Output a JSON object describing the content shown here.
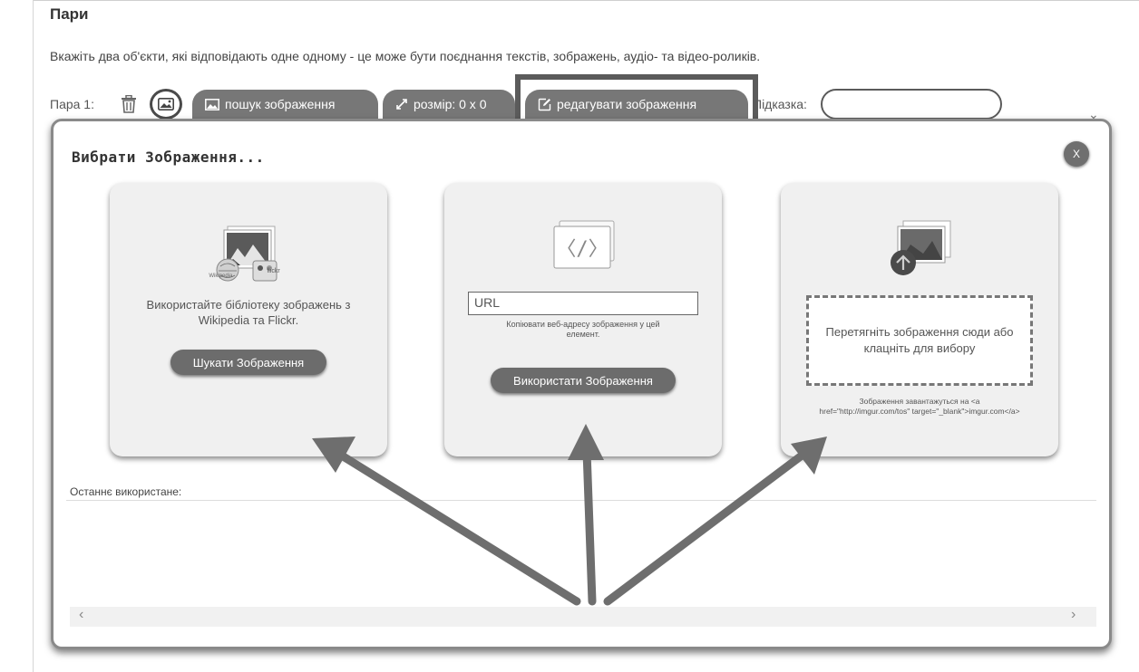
{
  "section": {
    "title": "Пари",
    "instructions": "Вкажіть два об'єкти, які відповідають одне одному - це може бути поєднання текстів, зображень, аудіо- та відео-роликів."
  },
  "pair_row": {
    "label": "Пара 1:",
    "search_image": "пошук зображення",
    "size": "розмір: 0 x 0",
    "edit_image": "редагувати зображення",
    "hint_label": "Підказка:",
    "hint_value": ""
  },
  "modal": {
    "title": "Вибрати Зображення...",
    "close": "X",
    "cards": {
      "library": {
        "description": "Використайте бібліотеку зображень з Wikipedia та Flickr.",
        "button": "Шукати Зображення",
        "icon_caption_1": "Wikipedia",
        "icon_caption_2": "flickr"
      },
      "url": {
        "input_placeholder": "URL",
        "description": "Копіювати веб-адресу зображення у цей елемент.",
        "button": "Використати Зображення"
      },
      "upload": {
        "dropzone_text": "Перетягніть зображення сюди або клацніть для вибору",
        "note": "Зображення завантажуться на <a href=\"http://imgur.com/tos\" target=\"_blank\">imgur.com</a>"
      }
    },
    "recent_label": "Останнє використане:"
  },
  "colors": {
    "button_gray": "#777777",
    "highlight_border": "#5b5b5b",
    "arrow_gray": "#6e6e6e"
  }
}
